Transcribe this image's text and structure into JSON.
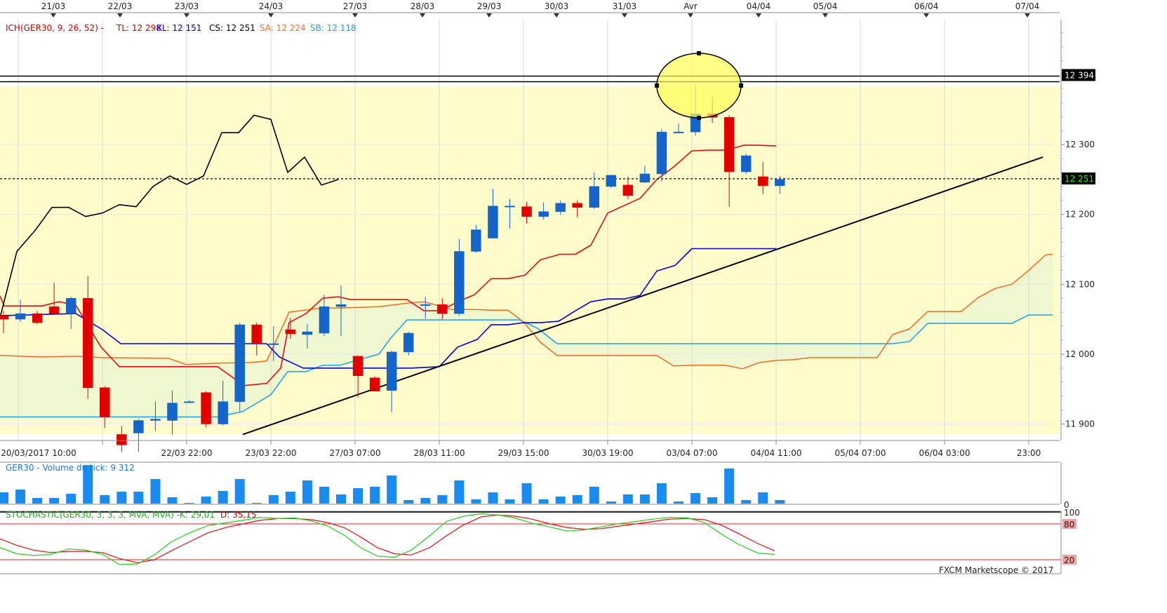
{
  "chart_data": {
    "type": "candlestick",
    "instrument": "GER30",
    "date_axis_labels": [
      "21/03",
      "22/03",
      "23/03",
      "24/03",
      "27/03",
      "28/03",
      "29/03",
      "30/03",
      "31/03",
      "Avr",
      "04/04",
      "05/04",
      "06/04",
      "07/04"
    ],
    "time_axis_labels": [
      "20/03/2017 10:00",
      "22/03 22:00",
      "23/03 22:00",
      "27/03 07:00",
      "28/03 11:00",
      "29/03 15:00",
      "30/03 19:00",
      "03/04 07:00",
      "04/04 11:00",
      "05/04 07:00",
      "06/04 03:00",
      "23:00"
    ],
    "price_axis": {
      "ticks": [
        "12 300",
        "12 200",
        "12 100",
        "12 000",
        "11 900"
      ],
      "tick_values": [
        12300,
        12200,
        12100,
        12000,
        11900
      ],
      "ylim": [
        11880,
        12490
      ]
    },
    "legend": {
      "ichimoku": "ICH(GER30, 9, 26, 52) -",
      "tl": "TL: 12 298",
      "kl": "KL: 12 151",
      "cs": "CS: 12 251",
      "sa": "SA: 12 224",
      "sb": "SB: 12 118"
    },
    "price_tags": {
      "resistance": "12 394",
      "current": "12 251"
    },
    "levels": {
      "resistance_top": 12398,
      "resistance_bottom": 12390,
      "current": 12251
    },
    "candles": [
      {
        "o": 12055,
        "h": 12062,
        "l": 12030,
        "c": 12050
      },
      {
        "o": 12050,
        "h": 12078,
        "l": 12046,
        "c": 12058
      },
      {
        "o": 12058,
        "h": 12062,
        "l": 12043,
        "c": 12045
      },
      {
        "o": 12068,
        "h": 12102,
        "l": 12056,
        "c": 12058
      },
      {
        "o": 12058,
        "h": 12082,
        "l": 12036,
        "c": 12080
      },
      {
        "o": 12080,
        "h": 12112,
        "l": 11936,
        "c": 11952
      },
      {
        "o": 11952,
        "h": 11954,
        "l": 11894,
        "c": 11910
      },
      {
        "o": 11885,
        "h": 11897,
        "l": 11860,
        "c": 11870
      },
      {
        "o": 11887,
        "h": 11907,
        "l": 11860,
        "c": 11905
      },
      {
        "o": 11905,
        "h": 11932,
        "l": 11890,
        "c": 11907
      },
      {
        "o": 11905,
        "h": 11948,
        "l": 11885,
        "c": 11930
      },
      {
        "o": 11932,
        "h": 11934,
        "l": 11930,
        "c": 11932
      },
      {
        "o": 11945,
        "h": 11947,
        "l": 11895,
        "c": 11900
      },
      {
        "o": 11900,
        "h": 11962,
        "l": 11898,
        "c": 11932
      },
      {
        "o": 11932,
        "h": 12045,
        "l": 11918,
        "c": 12042
      },
      {
        "o": 12042,
        "h": 12045,
        "l": 11998,
        "c": 12015
      },
      {
        "o": 12015,
        "h": 12040,
        "l": 11990,
        "c": 12015
      },
      {
        "o": 12035,
        "h": 12052,
        "l": 12022,
        "c": 12029
      },
      {
        "o": 12028,
        "h": 12043,
        "l": 12008,
        "c": 12032
      },
      {
        "o": 12030,
        "h": 12085,
        "l": 12026,
        "c": 12068
      },
      {
        "o": 12068,
        "h": 12098,
        "l": 12026,
        "c": 12071
      },
      {
        "o": 11997,
        "h": 11998,
        "l": 11938,
        "c": 11969
      },
      {
        "o": 11966,
        "h": 11968,
        "l": 11947,
        "c": 11947
      },
      {
        "o": 11948,
        "h": 12005,
        "l": 11917,
        "c": 12003
      },
      {
        "o": 12003,
        "h": 12032,
        "l": 11998,
        "c": 12030
      },
      {
        "o": 12071,
        "h": 12082,
        "l": 12051,
        "c": 12071
      },
      {
        "o": 12071,
        "h": 12080,
        "l": 12050,
        "c": 12058
      },
      {
        "o": 12058,
        "h": 12165,
        "l": 12055,
        "c": 12147
      },
      {
        "o": 12147,
        "h": 12185,
        "l": 12145,
        "c": 12178
      },
      {
        "o": 12166,
        "h": 12237,
        "l": 12166,
        "c": 12212
      },
      {
        "o": 12212,
        "h": 12222,
        "l": 12180,
        "c": 12212
      },
      {
        "o": 12211,
        "h": 12218,
        "l": 12187,
        "c": 12197
      },
      {
        "o": 12197,
        "h": 12217,
        "l": 12193,
        "c": 12204
      },
      {
        "o": 12204,
        "h": 12220,
        "l": 12200,
        "c": 12216
      },
      {
        "o": 12216,
        "h": 12220,
        "l": 12196,
        "c": 12210
      },
      {
        "o": 12210,
        "h": 12260,
        "l": 12208,
        "c": 12240
      },
      {
        "o": 12240,
        "h": 12257,
        "l": 12238,
        "c": 12256
      },
      {
        "o": 12242,
        "h": 12254,
        "l": 12222,
        "c": 12227
      },
      {
        "o": 12246,
        "h": 12270,
        "l": 12245,
        "c": 12258
      },
      {
        "o": 12258,
        "h": 12322,
        "l": 12247,
        "c": 12318
      },
      {
        "o": 12318,
        "h": 12330,
        "l": 12316,
        "c": 12318
      },
      {
        "o": 12318,
        "h": 12385,
        "l": 12313,
        "c": 12344
      },
      {
        "o": 12344,
        "h": 12368,
        "l": 12331,
        "c": 12339
      },
      {
        "o": 12339,
        "h": 12342,
        "l": 12211,
        "c": 12261
      },
      {
        "o": 12261,
        "h": 12287,
        "l": 12258,
        "c": 12284
      },
      {
        "o": 12254,
        "h": 12275,
        "l": 12229,
        "c": 12241
      },
      {
        "o": 12241,
        "h": 12255,
        "l": 12229,
        "c": 12250
      }
    ],
    "tenkan_tl": [
      [
        0,
        12083
      ],
      [
        6,
        12069
      ],
      [
        36,
        12069
      ],
      [
        60,
        12069
      ],
      [
        84,
        12075
      ],
      [
        108,
        12070
      ],
      [
        144,
        12010
      ],
      [
        170,
        11982
      ],
      [
        240,
        11982
      ],
      [
        270,
        11982
      ],
      [
        310,
        11982
      ],
      [
        348,
        11955
      ],
      [
        380,
        11958
      ],
      [
        400,
        11980
      ],
      [
        412,
        12045
      ],
      [
        436,
        12058
      ],
      [
        460,
        12080
      ],
      [
        482,
        12082
      ],
      [
        500,
        12078
      ],
      [
        540,
        12078
      ],
      [
        580,
        12078
      ],
      [
        604,
        12062
      ],
      [
        628,
        12062
      ],
      [
        652,
        12075
      ],
      [
        676,
        12085
      ],
      [
        700,
        12108
      ],
      [
        724,
        12108
      ],
      [
        748,
        12113
      ],
      [
        770,
        12135
      ],
      [
        798,
        12143
      ],
      [
        820,
        12143
      ],
      [
        842,
        12156
      ],
      [
        866,
        12202
      ],
      [
        890,
        12213
      ],
      [
        912,
        12223
      ],
      [
        936,
        12250
      ],
      [
        960,
        12268
      ],
      [
        986,
        12291
      ],
      [
        1010,
        12292
      ],
      [
        1034,
        12292
      ],
      [
        1060,
        12299
      ],
      [
        1080,
        12299
      ],
      [
        1106,
        12298
      ]
    ],
    "kijun_kl": [
      [
        0,
        12055
      ],
      [
        108,
        12058
      ],
      [
        146,
        12035
      ],
      [
        172,
        12015
      ],
      [
        246,
        12015
      ],
      [
        274,
        12015
      ],
      [
        310,
        12015
      ],
      [
        356,
        12015
      ],
      [
        380,
        12015
      ],
      [
        398,
        11996
      ],
      [
        432,
        11980
      ],
      [
        458,
        11980
      ],
      [
        484,
        11980
      ],
      [
        500,
        11980
      ],
      [
        540,
        11980
      ],
      [
        586,
        11980
      ],
      [
        626,
        11982
      ],
      [
        652,
        12010
      ],
      [
        680,
        12021
      ],
      [
        700,
        12042
      ],
      [
        724,
        12042
      ],
      [
        746,
        12045
      ],
      [
        770,
        12045
      ],
      [
        796,
        12047
      ],
      [
        820,
        12062
      ],
      [
        842,
        12075
      ],
      [
        866,
        12079
      ],
      [
        890,
        12079
      ],
      [
        912,
        12084
      ],
      [
        936,
        12119
      ],
      [
        962,
        12127
      ],
      [
        986,
        12151
      ],
      [
        1034,
        12151
      ],
      [
        1080,
        12151
      ],
      [
        1106,
        12151
      ]
    ],
    "chikou_cs": [
      [
        0,
        12052
      ],
      [
        24,
        12147
      ],
      [
        50,
        12177
      ],
      [
        74,
        12210
      ],
      [
        98,
        12210
      ],
      [
        122,
        12197
      ],
      [
        146,
        12202
      ],
      [
        170,
        12214
      ],
      [
        194,
        12211
      ],
      [
        218,
        12240
      ],
      [
        242,
        12255
      ],
      [
        266,
        12243
      ],
      [
        290,
        12255
      ],
      [
        316,
        12317
      ],
      [
        340,
        12317
      ],
      [
        362,
        12342
      ],
      [
        386,
        12336
      ],
      [
        410,
        12260
      ],
      [
        434,
        12282
      ],
      [
        458,
        12242
      ],
      [
        482,
        12250
      ]
    ],
    "senkou_sa": [
      [
        0,
        11998
      ],
      [
        60,
        11996
      ],
      [
        110,
        11997
      ],
      [
        146,
        11995
      ],
      [
        240,
        11994
      ],
      [
        266,
        11985
      ],
      [
        310,
        11987
      ],
      [
        356,
        11988
      ],
      [
        380,
        11990
      ],
      [
        412,
        12060
      ],
      [
        434,
        12063
      ],
      [
        458,
        12066
      ],
      [
        484,
        12066
      ],
      [
        540,
        12068
      ],
      [
        580,
        12073
      ],
      [
        604,
        12075
      ],
      [
        644,
        12064
      ],
      [
        676,
        12064
      ],
      [
        700,
        12063
      ],
      [
        724,
        12063
      ],
      [
        746,
        12046
      ],
      [
        770,
        12017
      ],
      [
        794,
        11998
      ],
      [
        840,
        11998
      ],
      [
        866,
        11998
      ],
      [
        936,
        11998
      ],
      [
        960,
        11983
      ],
      [
        986,
        11984
      ],
      [
        1010,
        11984
      ],
      [
        1034,
        11984
      ],
      [
        1058,
        11979
      ],
      [
        1082,
        11988
      ],
      [
        1106,
        11991
      ],
      [
        1130,
        11992
      ],
      [
        1154,
        11995
      ],
      [
        1182,
        11995
      ],
      [
        1250,
        11995
      ],
      [
        1272,
        12028
      ],
      [
        1296,
        12036
      ],
      [
        1322,
        12061
      ],
      [
        1346,
        12061
      ],
      [
        1370,
        12061
      ],
      [
        1394,
        12081
      ],
      [
        1418,
        12094
      ],
      [
        1442,
        12100
      ],
      [
        1466,
        12120
      ],
      [
        1490,
        12142
      ],
      [
        1500,
        12143
      ]
    ],
    "senkou_sb": [
      [
        0,
        11910
      ],
      [
        110,
        11910
      ],
      [
        146,
        11910
      ],
      [
        240,
        11910
      ],
      [
        310,
        11910
      ],
      [
        346,
        11918
      ],
      [
        386,
        11942
      ],
      [
        410,
        11975
      ],
      [
        436,
        11975
      ],
      [
        460,
        11984
      ],
      [
        484,
        11984
      ],
      [
        540,
        12000
      ],
      [
        556,
        12022
      ],
      [
        580,
        12049
      ],
      [
        604,
        12049
      ],
      [
        676,
        12049
      ],
      [
        700,
        12049
      ],
      [
        740,
        12049
      ],
      [
        766,
        12037
      ],
      [
        794,
        12015
      ],
      [
        840,
        12015
      ],
      [
        936,
        12015
      ],
      [
        1010,
        12015
      ],
      [
        1106,
        12015
      ],
      [
        1250,
        12015
      ],
      [
        1272,
        12015
      ],
      [
        1296,
        12018
      ],
      [
        1322,
        12044
      ],
      [
        1346,
        12044
      ],
      [
        1442,
        12044
      ],
      [
        1466,
        12056
      ],
      [
        1500,
        12056
      ]
    ],
    "trendline": {
      "start": [
        346,
        11885
      ],
      "end": [
        1486,
        12282
      ]
    },
    "volume": {
      "label": "GER30 - Volume du tick: 9 312",
      "zero_label": "0",
      "values": [
        16,
        20,
        8,
        8,
        14,
        55,
        12,
        17,
        17,
        35,
        9,
        1,
        10,
        18,
        35,
        1,
        12,
        17,
        33,
        24,
        13,
        22,
        24,
        40,
        5,
        8,
        12,
        33,
        6,
        16,
        6,
        29,
        6,
        10,
        12,
        24,
        3,
        13,
        13,
        29,
        3,
        15,
        9,
        50,
        5,
        16,
        5
      ]
    },
    "stochastic": {
      "label_main": "STOCHASTIC(GER30, 3, 3, 3, MVA, MVA) -",
      "label_k": "K: 29,01",
      "label_d": "D: 35,15",
      "levels": [
        20,
        80,
        100
      ],
      "level_labels": [
        "20",
        "80",
        "100"
      ],
      "k": [
        [
          0,
          40
        ],
        [
          24,
          30
        ],
        [
          48,
          27
        ],
        [
          72,
          29
        ],
        [
          98,
          38
        ],
        [
          122,
          36
        ],
        [
          146,
          29
        ],
        [
          170,
          12
        ],
        [
          196,
          13
        ],
        [
          220,
          28
        ],
        [
          244,
          50
        ],
        [
          270,
          65
        ],
        [
          296,
          77
        ],
        [
          322,
          82
        ],
        [
          346,
          86
        ],
        [
          370,
          91
        ],
        [
          396,
          89
        ],
        [
          420,
          90
        ],
        [
          444,
          85
        ],
        [
          468,
          76
        ],
        [
          492,
          60
        ],
        [
          514,
          40
        ],
        [
          538,
          26
        ],
        [
          562,
          24
        ],
        [
          586,
          36
        ],
        [
          612,
          60
        ],
        [
          636,
          84
        ],
        [
          660,
          93
        ],
        [
          686,
          97
        ],
        [
          710,
          95
        ],
        [
          734,
          90
        ],
        [
          758,
          81
        ],
        [
          784,
          75
        ],
        [
          808,
          68
        ],
        [
          832,
          70
        ],
        [
          856,
          75
        ],
        [
          880,
          80
        ],
        [
          906,
          84
        ],
        [
          930,
          88
        ],
        [
          954,
          91
        ],
        [
          980,
          90
        ],
        [
          1004,
          82
        ],
        [
          1028,
          63
        ],
        [
          1052,
          46
        ],
        [
          1080,
          31
        ],
        [
          1104,
          29
        ]
      ],
      "d": [
        [
          0,
          55
        ],
        [
          24,
          44
        ],
        [
          48,
          36
        ],
        [
          72,
          32
        ],
        [
          98,
          34
        ],
        [
          122,
          34
        ],
        [
          146,
          32
        ],
        [
          170,
          22
        ],
        [
          196,
          15
        ],
        [
          220,
          20
        ],
        [
          244,
          35
        ],
        [
          270,
          50
        ],
        [
          296,
          65
        ],
        [
          322,
          74
        ],
        [
          346,
          80
        ],
        [
          370,
          86
        ],
        [
          396,
          89
        ],
        [
          420,
          89
        ],
        [
          444,
          87
        ],
        [
          468,
          82
        ],
        [
          492,
          73
        ],
        [
          514,
          58
        ],
        [
          538,
          40
        ],
        [
          562,
          30
        ],
        [
          586,
          28
        ],
        [
          612,
          40
        ],
        [
          636,
          60
        ],
        [
          660,
          78
        ],
        [
          686,
          92
        ],
        [
          710,
          95
        ],
        [
          734,
          93
        ],
        [
          758,
          88
        ],
        [
          784,
          80
        ],
        [
          808,
          74
        ],
        [
          832,
          71
        ],
        [
          856,
          72
        ],
        [
          880,
          76
        ],
        [
          906,
          80
        ],
        [
          930,
          84
        ],
        [
          954,
          88
        ],
        [
          980,
          89
        ],
        [
          1004,
          87
        ],
        [
          1028,
          78
        ],
        [
          1052,
          64
        ],
        [
          1080,
          47
        ],
        [
          1104,
          35
        ]
      ]
    },
    "copyright": "FXCM Marketscope © 2017"
  }
}
